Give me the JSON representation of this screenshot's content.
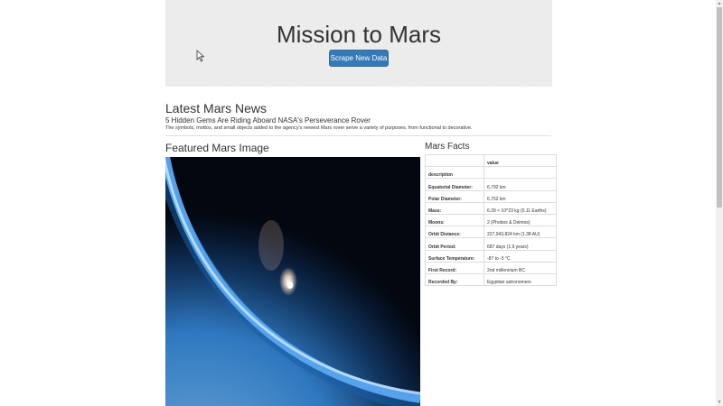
{
  "header": {
    "title": "Mission to Mars",
    "scrape_button_label": "Scrape New Data"
  },
  "news": {
    "section_title": "Latest Mars News",
    "headline": "5 Hidden Gems Are Riding Aboard NASA's Perseverance Rover",
    "teaser": "The symbols, mottos, and small objects added to the agency's newest Mars rover serve a variety of purposes, from functional to decorative."
  },
  "featured": {
    "section_title": "Featured Mars Image"
  },
  "facts": {
    "section_title": "Mars Facts",
    "header_col2": "value",
    "index_label": "description",
    "rows": [
      {
        "label": "Equatorial Diameter:",
        "value": "6,792 km"
      },
      {
        "label": "Polar Diameter:",
        "value": "6,752 km"
      },
      {
        "label": "Mass:",
        "value": "6.39 × 10^23 kg (0.11 Earths)"
      },
      {
        "label": "Moons:",
        "value": "2 (Phobos & Deimos)"
      },
      {
        "label": "Orbit Distance:",
        "value": "227,943,824 km (1.38 AU)"
      },
      {
        "label": "Orbit Period:",
        "value": "687 days (1.9 years)"
      },
      {
        "label": "Surface Temperature:",
        "value": "-87 to -5 °C"
      },
      {
        "label": "First Record:",
        "value": "2nd millennium BC"
      },
      {
        "label": "Recorded By:",
        "value": "Egyptian astronomers"
      }
    ]
  },
  "colors": {
    "button_bg": "#337ab7",
    "jumbotron_bg": "#eeeeee",
    "atmosphere_blue": "#5aa8f0"
  }
}
